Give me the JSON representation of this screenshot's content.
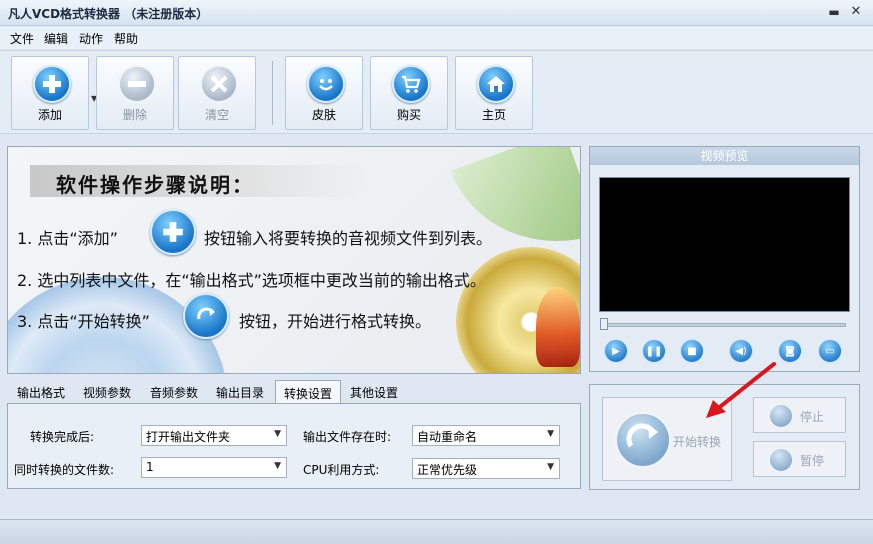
{
  "window": {
    "title": "凡人VCD格式转换器 （未注册版本）",
    "minimize_glyph": "▬",
    "close_glyph": "✕"
  },
  "menu": {
    "items": [
      "文件",
      "编辑",
      "动作",
      "帮助"
    ]
  },
  "toolbar": {
    "add_label": "添加",
    "delete_label": "删除",
    "clear_label": "清空",
    "skin_label": "皮肤",
    "buy_label": "购买",
    "home_label": "主页"
  },
  "guide": {
    "heading": "软件操作步骤说明：",
    "step1_before": "1. 点击“添加”",
    "step1_after": "按钮输入将要转换的音视频文件到列表。",
    "step2": "2. 选中列表中文件，在“输出格式”选项框中更改当前的输出格式。",
    "step3_before": "3. 点击“开始转换”",
    "step3_after": "按钮，开始进行格式转换。"
  },
  "tabs": [
    "输出格式",
    "视频参数",
    "音频参数",
    "输出目录",
    "转换设置",
    "其他设置"
  ],
  "active_tab": "转换设置",
  "settings": {
    "after_convert_label": "转换完成后:",
    "after_convert_value": "打开输出文件夹",
    "file_exists_label": "输出文件存在时:",
    "file_exists_value": "自动重命名",
    "concurrent_label": "同时转换的文件数:",
    "concurrent_value": "1",
    "cpu_label": "CPU利用方式:",
    "cpu_value": "正常优先级"
  },
  "preview": {
    "title": "视频预览"
  },
  "actions": {
    "start_label": "开始转换",
    "stop_label": "停止",
    "pause_label": "暂停"
  },
  "colors": {
    "accent_blue": "#1875c8",
    "title_bar": "#d6e3f0",
    "arrow_red": "#d9181e"
  }
}
